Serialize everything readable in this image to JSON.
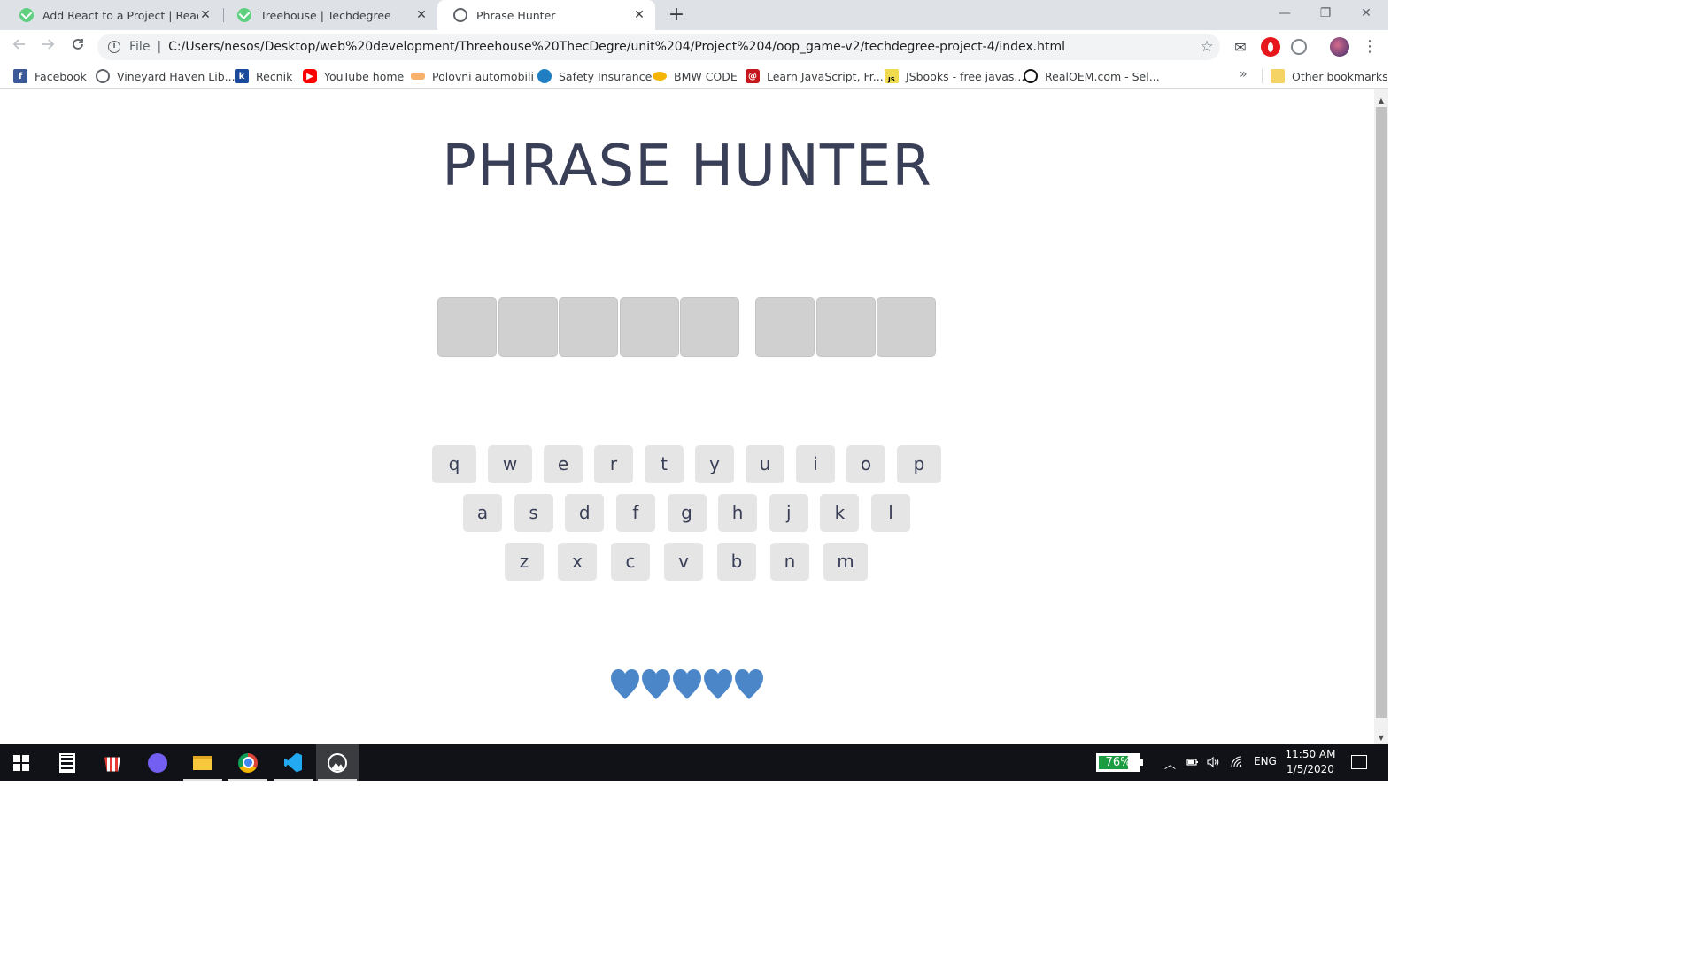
{
  "browser": {
    "tabs": [
      {
        "label": "Add React to a Project | React Ba",
        "icon": "treehouse-icon",
        "active": false
      },
      {
        "label": "Treehouse | Techdegree",
        "icon": "treehouse-icon",
        "active": false
      },
      {
        "label": "Phrase Hunter",
        "icon": "globe-icon",
        "active": true
      }
    ],
    "tab_close_glyph": "✕",
    "new_tab_glyph": "+",
    "window_controls": {
      "minimize": "—",
      "restore": "❐",
      "close": "✕"
    },
    "address": {
      "scheme_label": "File",
      "url": "C:/Users/nesos/Desktop/web%20development/Threehouse%20ThecDegre/unit%204/Project%204/oop_game-v2/techdegree-project-4/index.html"
    },
    "bookmarks": [
      {
        "label": "Facebook",
        "icon": "facebook-icon"
      },
      {
        "label": "Vineyard Haven Lib...",
        "icon": "globe-icon"
      },
      {
        "label": "Recnik",
        "icon": "k-icon"
      },
      {
        "label": "YouTube home",
        "icon": "youtube-icon"
      },
      {
        "label": "Polovni automobili",
        "icon": "car-icon"
      },
      {
        "label": "Safety Insurance",
        "icon": "safety-icon"
      },
      {
        "label": "BMW CODE",
        "icon": "bmw-code-icon"
      },
      {
        "label": "Learn JavaScript, Fr...",
        "icon": "learn-icon"
      },
      {
        "label": "JSbooks - free javas...",
        "icon": "js-icon"
      },
      {
        "label": "RealOEM.com - Sel...",
        "icon": "bmw-icon"
      }
    ],
    "bookmarks_more": "»",
    "other_bookmarks": "Other bookmarks"
  },
  "game": {
    "title": "PHRASE HUNTER",
    "phrase_words": [
      5,
      3
    ],
    "keyboard": {
      "row1": [
        "q",
        "w",
        "e",
        "r",
        "t",
        "y",
        "u",
        "i",
        "o",
        "p"
      ],
      "row2": [
        "a",
        "s",
        "d",
        "f",
        "g",
        "h",
        "j",
        "k",
        "l"
      ],
      "row3": [
        "z",
        "x",
        "c",
        "v",
        "b",
        "n",
        "m"
      ]
    },
    "lives": 5,
    "heart_color": "#4a86c8"
  },
  "taskbar": {
    "apps": [
      "windows-start-icon",
      "calculator-icon",
      "popcorn-icon",
      "viber-icon",
      "file-explorer-icon",
      "chrome-icon",
      "vscode-icon",
      "photo-app-icon"
    ],
    "battery_percent": "76%",
    "battery_level": 0.76,
    "language": "ENG",
    "time": "11:50 AM",
    "date": "1/5/2020"
  },
  "colors": {
    "title": "#3a3f58",
    "tile": "#d0d0d0",
    "key": "#e5e5e5",
    "battery_fill": "#1c9c40"
  }
}
